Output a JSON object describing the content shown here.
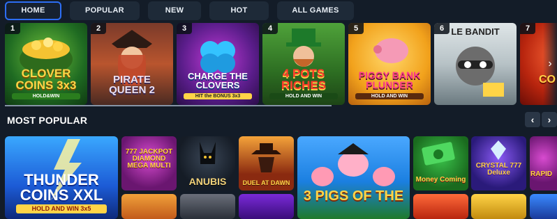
{
  "tabs": [
    {
      "label": "HOME",
      "active": true
    },
    {
      "label": "POPULAR",
      "active": false
    },
    {
      "label": "NEW",
      "active": false
    },
    {
      "label": "HOT",
      "active": false
    },
    {
      "label": "ALL GAMES",
      "active": false
    }
  ],
  "top_games": [
    {
      "rank": "1",
      "title": "CLOVER COINS 3x3",
      "subtitle": "HOLD&WIN"
    },
    {
      "rank": "2",
      "title": "PIRATE QUEEN 2",
      "subtitle": ""
    },
    {
      "rank": "3",
      "title": "CHARGE THE CLOVERS",
      "subtitle": "HIT the BONUS 3x3"
    },
    {
      "rank": "4",
      "title": "4 POTS RICHES",
      "subtitle": "HOLD AND WIN"
    },
    {
      "rank": "5",
      "title": "PIGGY BANK PLUNDER",
      "subtitle": "HOLD AND WIN"
    },
    {
      "rank": "6",
      "title": "LE BANDIT",
      "subtitle": ""
    },
    {
      "rank": "7",
      "title": "CO NON",
      "subtitle": ""
    }
  ],
  "section": {
    "title": "MOST POPULAR",
    "prev": "‹",
    "next": "›"
  },
  "strip_next": "›",
  "popular_games": [
    {
      "title": "THUNDER COINS XXL",
      "subtitle": "HOLD AND WIN 3x5"
    },
    {
      "title": "777 JACKPOT DIAMOND MEGA MULTI"
    },
    {
      "title": "ANUBIS"
    },
    {
      "title": "DUEL AT DAWN"
    },
    {
      "title": "3 PIGS OF THE"
    },
    {
      "title": "Money Coming"
    },
    {
      "title": "CRYSTAL 777 Deluxe"
    },
    {
      "title": "RAPID"
    }
  ]
}
